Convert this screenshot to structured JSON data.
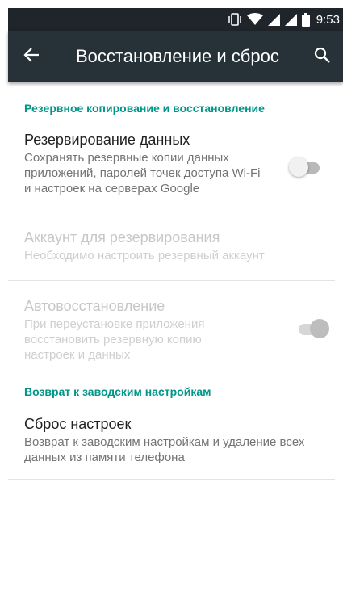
{
  "status_bar": {
    "time": "9:53",
    "icons": [
      "vibrate-icon",
      "wifi-icon",
      "signal-icon",
      "signal-icon",
      "battery-icon"
    ]
  },
  "app_bar": {
    "title": "Восстановление и сброс",
    "back_icon": "arrow-back-icon",
    "search_icon": "search-icon"
  },
  "sections": {
    "backup": {
      "header": "Резервное копирование и восстановление",
      "backup_data": {
        "title": "Резервирование данных",
        "summary": "Сохранять резервные копии данных приложений, паролей точек доступа Wi-Fi и настроек на серверах Google",
        "switch_on": false
      },
      "backup_account": {
        "title": "Аккаунт для резервирования",
        "summary": "Необходимо настроить резервный аккаунт",
        "enabled": false
      },
      "auto_restore": {
        "title": "Автовосстановление",
        "summary": "При переустановке приложения восстановить резервную копию настроек и данных",
        "switch_on": true,
        "enabled": false
      }
    },
    "reset": {
      "header": "Возврат к заводским настройкам",
      "factory_reset": {
        "title": "Сброс настроек",
        "summary": "Возврат к заводским настройкам и удаление всех данных из памяти телефона"
      }
    }
  },
  "colors": {
    "status_bar": "#1f252a",
    "app_bar": "#263238",
    "accent": "#009688",
    "title_text": "#212121",
    "summary_text": "#737373",
    "disabled_text": "#c7c7c7"
  }
}
